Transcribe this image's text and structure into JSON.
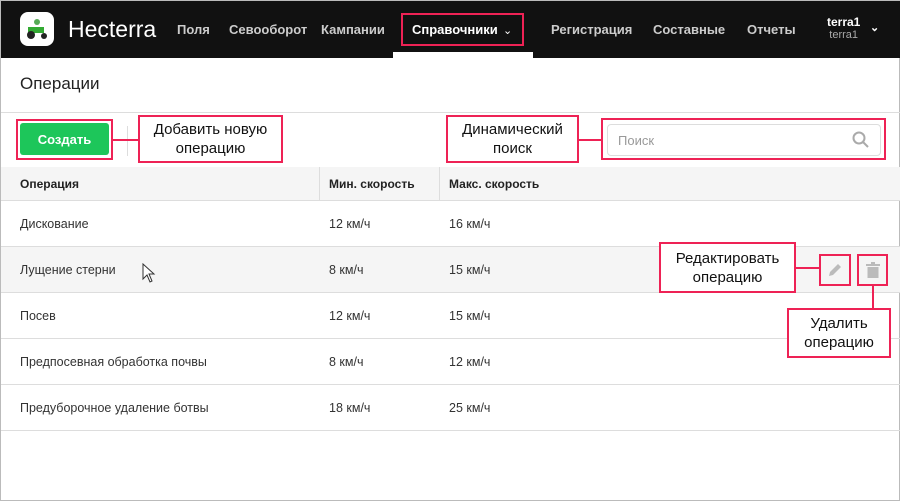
{
  "header": {
    "brand": "Hecterra",
    "nav": [
      "Поля",
      "Севооборот",
      "Кампании",
      "Справочники",
      "Регистрация",
      "Составные",
      "Отчеты"
    ],
    "active": "Справочники",
    "user": {
      "name": "terra1",
      "login": "terra1"
    }
  },
  "page": {
    "title": "Операции",
    "create_label": "Создать",
    "search_placeholder": "Поиск"
  },
  "table": {
    "columns": [
      "Операция",
      "Мин. скорость",
      "Макс. скорость"
    ],
    "rows": [
      [
        "Дискование",
        "12 км/ч",
        "16 км/ч"
      ],
      [
        "Лущение стерни",
        "8 км/ч",
        "15 км/ч"
      ],
      [
        "Посев",
        "12 км/ч",
        "15 км/ч"
      ],
      [
        "Предпосевная обработка почвы",
        "8 км/ч",
        "12 км/ч"
      ],
      [
        "Предуборочное удаление ботвы",
        "18 км/ч",
        "25 км/ч"
      ]
    ]
  },
  "annotations": {
    "add": "Добавить новую операцию",
    "search": "Динамический поиск",
    "edit": "Редактировать операцию",
    "delete": "Удалить операцию"
  },
  "colors": {
    "accent": "#1dc65a",
    "annotation": "#ee2255",
    "header": "#111111"
  }
}
